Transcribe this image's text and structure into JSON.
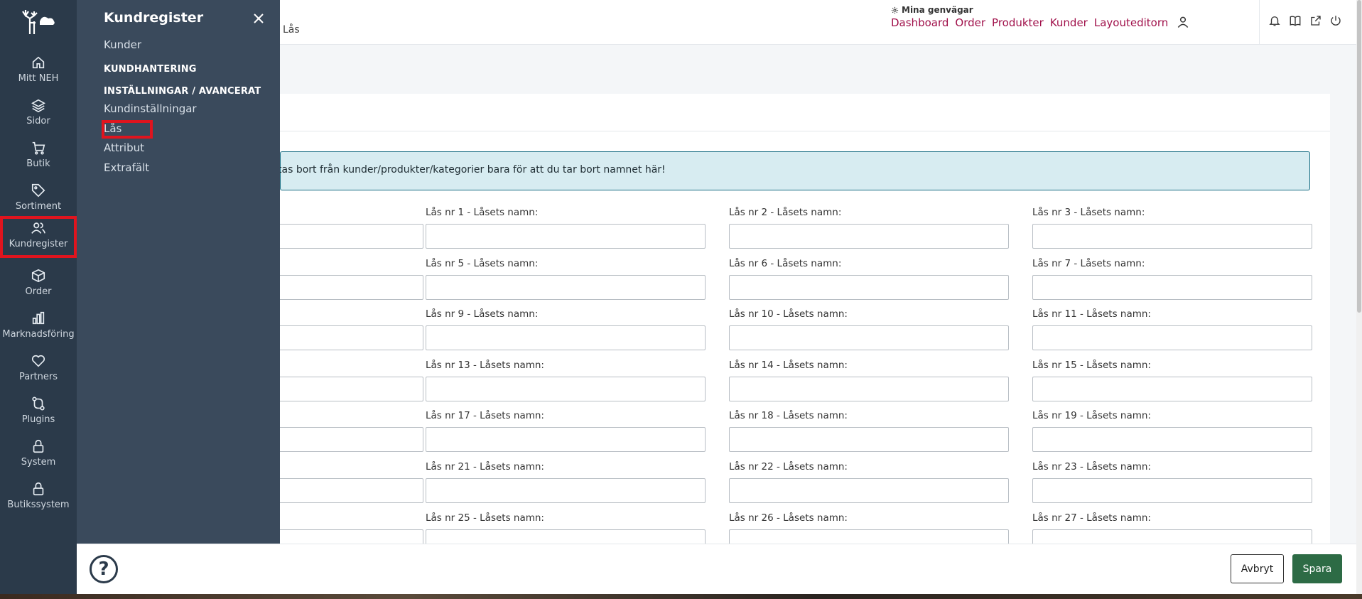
{
  "rail": {
    "items": [
      {
        "label": "Mitt NEH",
        "icon": "home-icon"
      },
      {
        "label": "Sidor",
        "icon": "layers-icon"
      },
      {
        "label": "Butik",
        "icon": "cart-icon"
      },
      {
        "label": "Sortiment",
        "icon": "tag-icon"
      },
      {
        "label": "Kundregister",
        "icon": "users-icon"
      },
      {
        "label": "Order",
        "icon": "box-icon"
      },
      {
        "label": "Marknadsföring",
        "icon": "bar-chart-icon"
      },
      {
        "label": "Partners",
        "icon": "heart-icon"
      },
      {
        "label": "Plugins",
        "icon": "plugin-icon"
      },
      {
        "label": "System",
        "icon": "lock-icon"
      },
      {
        "label": "Butikssystem",
        "icon": "lock-icon"
      }
    ]
  },
  "flyout": {
    "title": "Kundregister",
    "link_kunder": "Kunder",
    "heading_kundhantering": "KUNDHANTERING",
    "heading_installningar": "INSTÄLLNINGAR / AVANCERAT",
    "link_kundinstallningar": "Kundinställningar",
    "link_las": "Lås",
    "link_attribut": "Attribut",
    "link_extrafalt": "Extrafält"
  },
  "topbar": {
    "breadcrumb": "Lås",
    "shortcuts_heading": "Mina genvägar",
    "shortcuts": [
      "Dashboard",
      "Order",
      "Produkter",
      "Kunder",
      "Layouteditorn"
    ]
  },
  "info_text": "tas bort från kunder/produkter/kategorier bara för att du tar bort namnet här!",
  "lock_fields": [
    [
      "Lås nr 1 - Låsets namn:",
      "Lås nr 2 - Låsets namn:",
      "Lås nr 3 - Låsets namn:"
    ],
    [
      "Lås nr 5 - Låsets namn:",
      "Lås nr 6 - Låsets namn:",
      "Lås nr 7 - Låsets namn:"
    ],
    [
      "Lås nr 9 - Låsets namn:",
      "Lås nr 10 - Låsets namn:",
      "Lås nr 11 - Låsets namn:"
    ],
    [
      "Lås nr 13 - Låsets namn:",
      "Lås nr 14 - Låsets namn:",
      "Lås nr 15 - Låsets namn:"
    ],
    [
      "Lås nr 17 - Låsets namn:",
      "Lås nr 18 - Låsets namn:",
      "Lås nr 19 - Låsets namn:"
    ],
    [
      "Lås nr 21 - Låsets namn:",
      "Lås nr 22 - Låsets namn:",
      "Lås nr 23 - Låsets namn:"
    ],
    [
      "Lås nr 25 - Låsets namn:",
      "Lås nr 26 - Låsets namn:",
      "Lås nr 27 - Låsets namn:"
    ]
  ],
  "footer": {
    "help_glyph": "?",
    "cancel_label": "Avbryt",
    "save_label": "Spara"
  },
  "colors": {
    "rail_bg": "#2b3a4a",
    "flyout_bg": "#3a4a5c",
    "link_accent": "#a0104a",
    "save_button": "#2d6b45",
    "highlight": "#e0141e",
    "info_bg": "#d7ecf1"
  }
}
